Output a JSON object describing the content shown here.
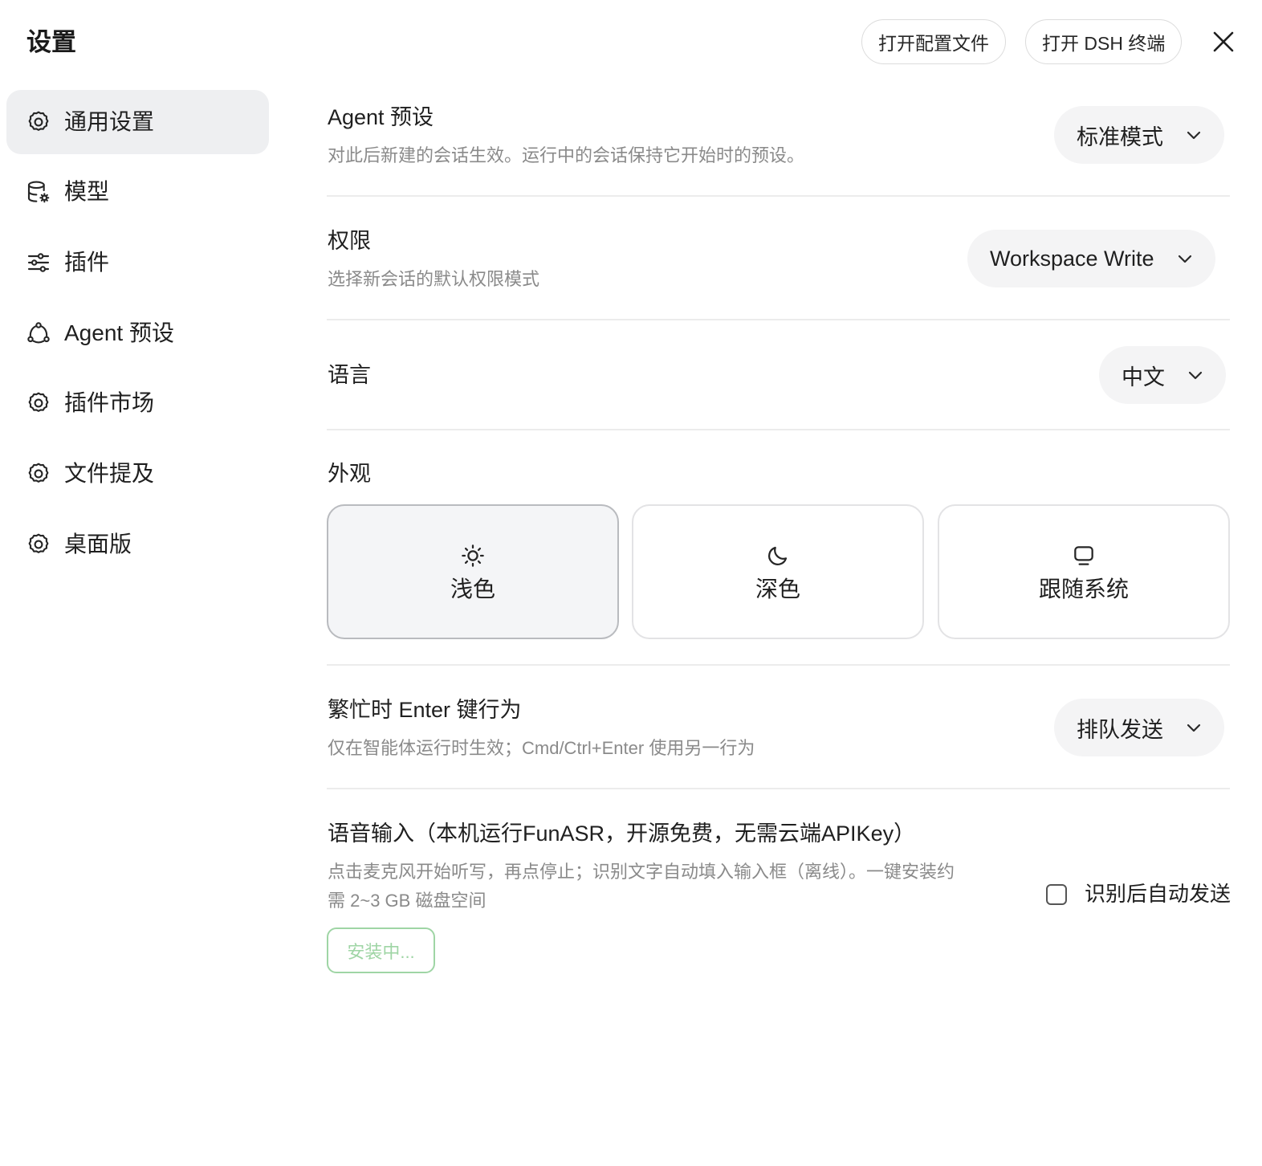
{
  "page": {
    "title": "设置"
  },
  "header": {
    "open_config_label": "打开配置文件",
    "open_terminal_label": "打开 DSH 终端",
    "close_icon": "close-icon"
  },
  "sidebar": {
    "items": [
      {
        "label": "通用设置",
        "icon": "gear-icon",
        "active": true
      },
      {
        "label": "模型",
        "icon": "database-gear-icon",
        "active": false
      },
      {
        "label": "插件",
        "icon": "sliders-icon",
        "active": false
      },
      {
        "label": "Agent 预设",
        "icon": "agent-nodes-icon",
        "active": false
      },
      {
        "label": "插件市场",
        "icon": "gear-icon",
        "active": false
      },
      {
        "label": "文件提及",
        "icon": "gear-icon",
        "active": false
      },
      {
        "label": "桌面版",
        "icon": "gear-icon",
        "active": false
      }
    ]
  },
  "settings": {
    "agent_preset": {
      "title": "Agent 预设",
      "description": "对此后新建的会话生效。运行中的会话保持它开始时的预设。",
      "value": "标准模式"
    },
    "permission": {
      "title": "权限",
      "description": "选择新会话的默认权限模式",
      "value": "Workspace Write"
    },
    "language": {
      "title": "语言",
      "value": "中文"
    },
    "appearance": {
      "title": "外观",
      "options": [
        {
          "label": "浅色",
          "icon": "sun-icon",
          "selected": true
        },
        {
          "label": "深色",
          "icon": "moon-icon",
          "selected": false
        },
        {
          "label": "跟随系统",
          "icon": "monitor-icon",
          "selected": false
        }
      ]
    },
    "busy_enter": {
      "title": "繁忙时 Enter 键行为",
      "description": "仅在智能体运行时生效；Cmd/Ctrl+Enter 使用另一行为",
      "value": "排队发送"
    },
    "voice_input": {
      "title": "语音输入（本机运行FunASR，开源免费，无需云端APIKey）",
      "description_line1": "点击麦克风开始听写，再点停止；识别文字自动填入输入框（离线）。一键安装约",
      "description_line2": "需 2~3 GB 磁盘空间",
      "install_label": "安装中...",
      "auto_send_label": "识别后自动发送",
      "auto_send_checked": false
    }
  },
  "colors": {
    "active_bg": "#eeeff1",
    "select_bg": "#f4f4f5",
    "install_green": "#9fd5a5",
    "muted_text": "#8a8a8a"
  }
}
